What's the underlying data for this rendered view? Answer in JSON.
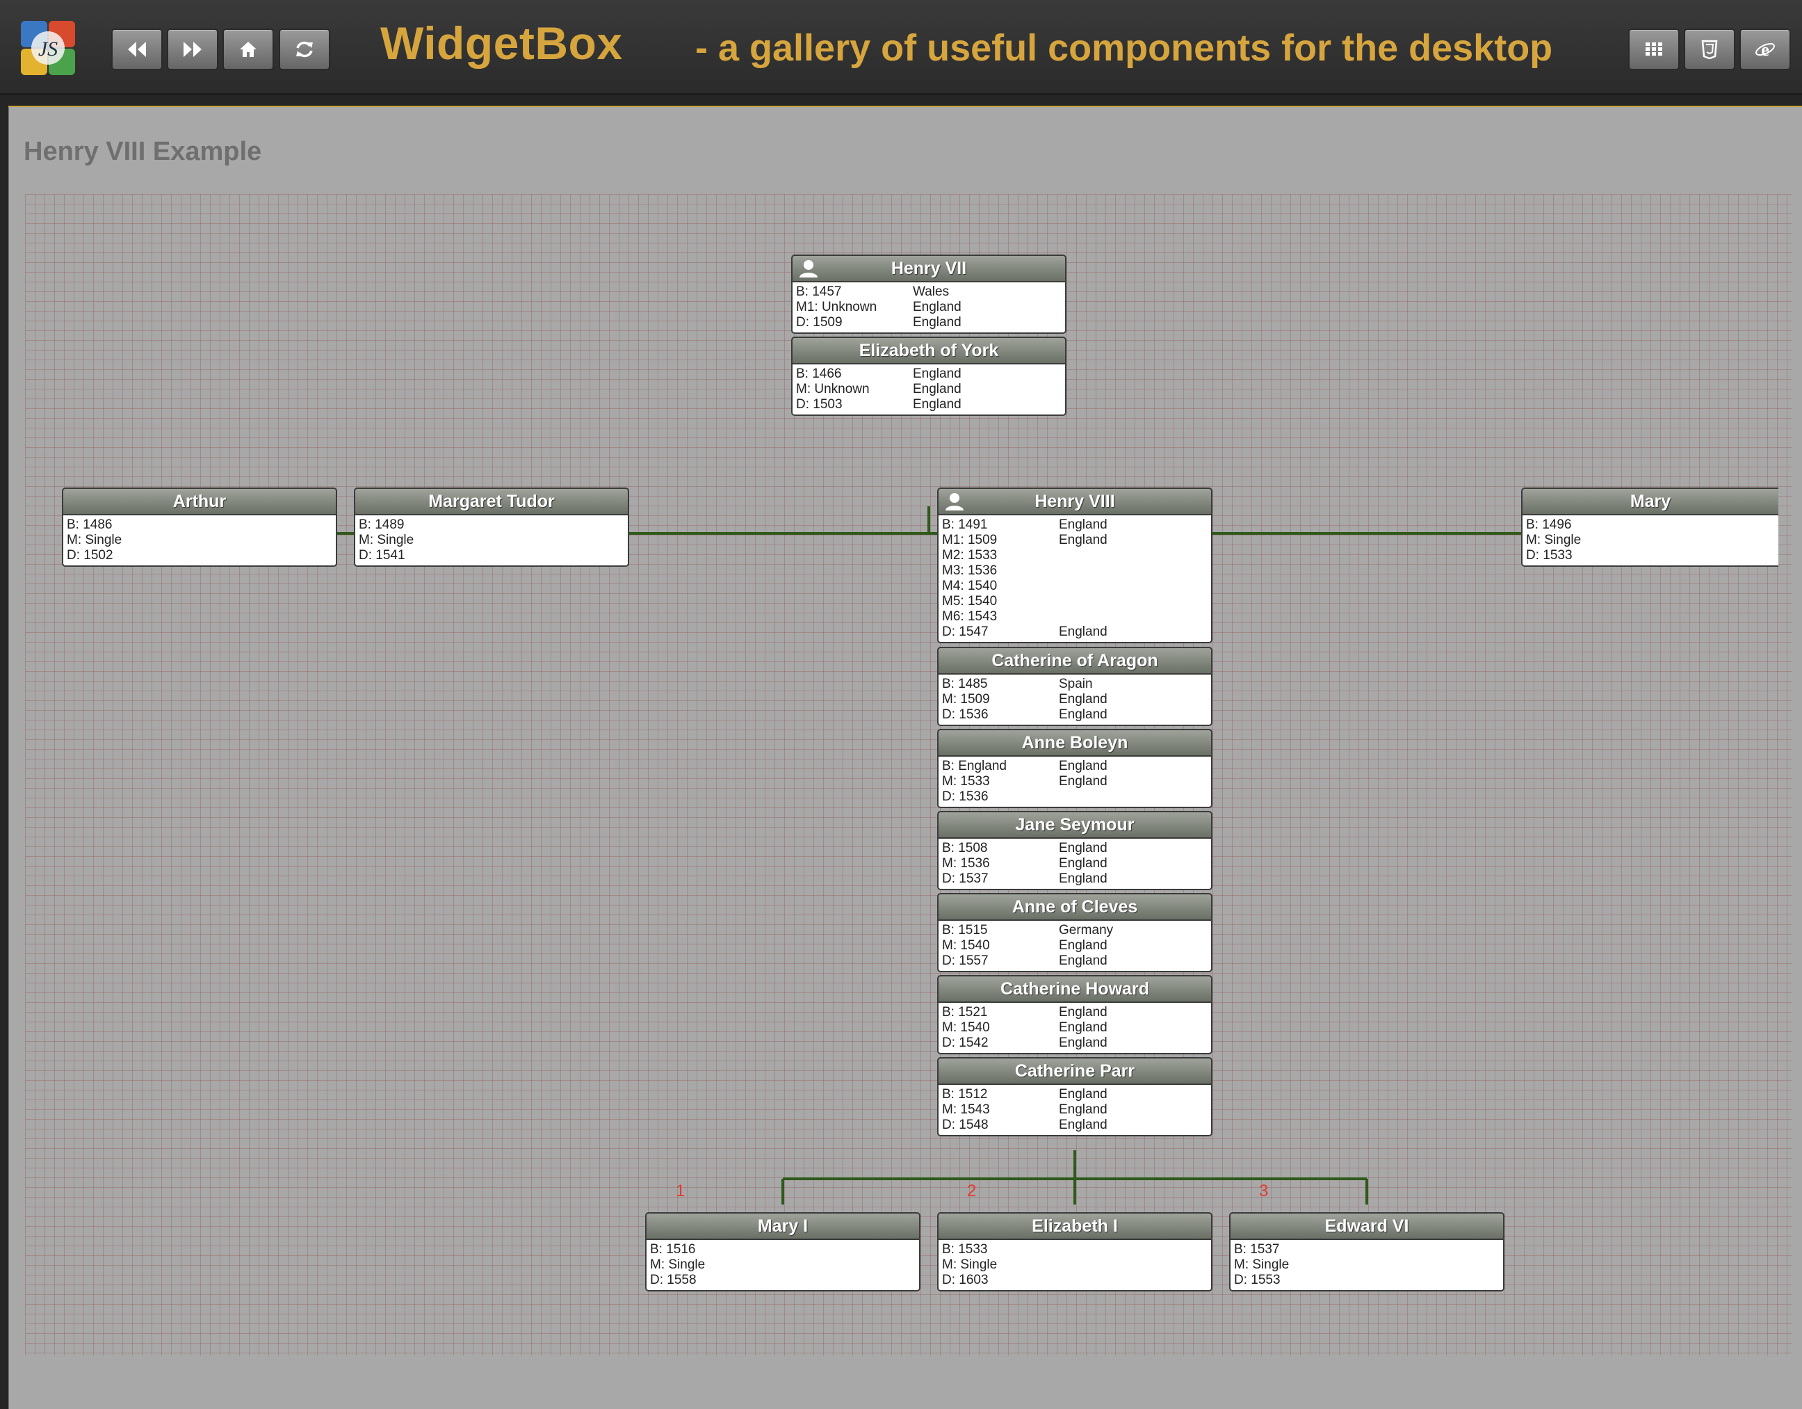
{
  "app": {
    "title": "WidgetBox",
    "subtitle": "- a gallery of useful components for the desktop",
    "logo_text": "JS",
    "nav_icons": [
      "rewind-icon",
      "fast-forward-icon",
      "home-icon",
      "refresh-icon"
    ],
    "right_icons": [
      "grid-icon",
      "html5-icon",
      "ie-icon"
    ],
    "accent_color": "#d7a53e"
  },
  "page": {
    "title": "Henry VIII Example"
  },
  "tree": {
    "henry7": {
      "name": "Henry VII",
      "has_icon": true,
      "rows": [
        [
          "B: 1457",
          "Wales"
        ],
        [
          "M1: Unknown",
          "England"
        ],
        [
          "D: 1509",
          "England"
        ]
      ]
    },
    "elizabeth_york": {
      "name": "Elizabeth of York",
      "rows": [
        [
          "B: 1466",
          "England"
        ],
        [
          "M: Unknown",
          "England"
        ],
        [
          "D: 1503",
          "England"
        ]
      ]
    },
    "arthur": {
      "name": "Arthur",
      "rows": [
        [
          "B: 1486",
          ""
        ],
        [
          "M: Single",
          ""
        ],
        [
          "D: 1502",
          ""
        ]
      ]
    },
    "margaret": {
      "name": "Margaret Tudor",
      "rows": [
        [
          "B: 1489",
          ""
        ],
        [
          "M: Single",
          ""
        ],
        [
          "D: 1541",
          ""
        ]
      ]
    },
    "henry8": {
      "name": "Henry VIII",
      "has_icon": true,
      "rows": [
        [
          "B: 1491",
          "England"
        ],
        [
          "M1: 1509",
          "England"
        ],
        [
          "M2: 1533",
          ""
        ],
        [
          "M3: 1536",
          ""
        ],
        [
          "M4: 1540",
          ""
        ],
        [
          "M5: 1540",
          ""
        ],
        [
          "M6: 1543",
          ""
        ],
        [
          "D: 1547",
          "England"
        ]
      ]
    },
    "mary": {
      "name": "Mary",
      "rows": [
        [
          "B: 1496",
          ""
        ],
        [
          "M: Single",
          ""
        ],
        [
          "D: 1533",
          ""
        ]
      ]
    },
    "wives": [
      {
        "name": "Catherine of Aragon",
        "rows": [
          [
            "B: 1485",
            "Spain"
          ],
          [
            "M: 1509",
            "England"
          ],
          [
            "D: 1536",
            "England"
          ]
        ]
      },
      {
        "name": "Anne Boleyn",
        "rows": [
          [
            "B: England",
            "England"
          ],
          [
            "M: 1533",
            "England"
          ],
          [
            "D: 1536",
            ""
          ]
        ]
      },
      {
        "name": "Jane Seymour",
        "rows": [
          [
            "B: 1508",
            "England"
          ],
          [
            "M: 1536",
            "England"
          ],
          [
            "D: 1537",
            "England"
          ]
        ]
      },
      {
        "name": "Anne of Cleves",
        "rows": [
          [
            "B: 1515",
            "Germany"
          ],
          [
            "M: 1540",
            "England"
          ],
          [
            "D: 1557",
            "England"
          ]
        ]
      },
      {
        "name": "Catherine Howard",
        "rows": [
          [
            "B: 1521",
            "England"
          ],
          [
            "M: 1540",
            "England"
          ],
          [
            "D: 1542",
            "England"
          ]
        ]
      },
      {
        "name": "Catherine Parr",
        "rows": [
          [
            "B: 1512",
            "England"
          ],
          [
            "M: 1543",
            "England"
          ],
          [
            "D: 1548",
            "England"
          ]
        ]
      }
    ],
    "children": [
      {
        "name": "Mary I",
        "index": "1",
        "rows": [
          [
            "B: 1516",
            ""
          ],
          [
            "M: Single",
            ""
          ],
          [
            "D: 1558",
            ""
          ]
        ]
      },
      {
        "name": "Elizabeth I",
        "index": "2",
        "rows": [
          [
            "B: 1533",
            ""
          ],
          [
            "M: Single",
            ""
          ],
          [
            "D: 1603",
            ""
          ]
        ]
      },
      {
        "name": "Edward VI",
        "index": "3",
        "rows": [
          [
            "B: 1537",
            ""
          ],
          [
            "M: Single",
            ""
          ],
          [
            "D: 1553",
            ""
          ]
        ]
      }
    ],
    "line_color": "#2e5a1c",
    "index_color": "#e23b2e"
  }
}
